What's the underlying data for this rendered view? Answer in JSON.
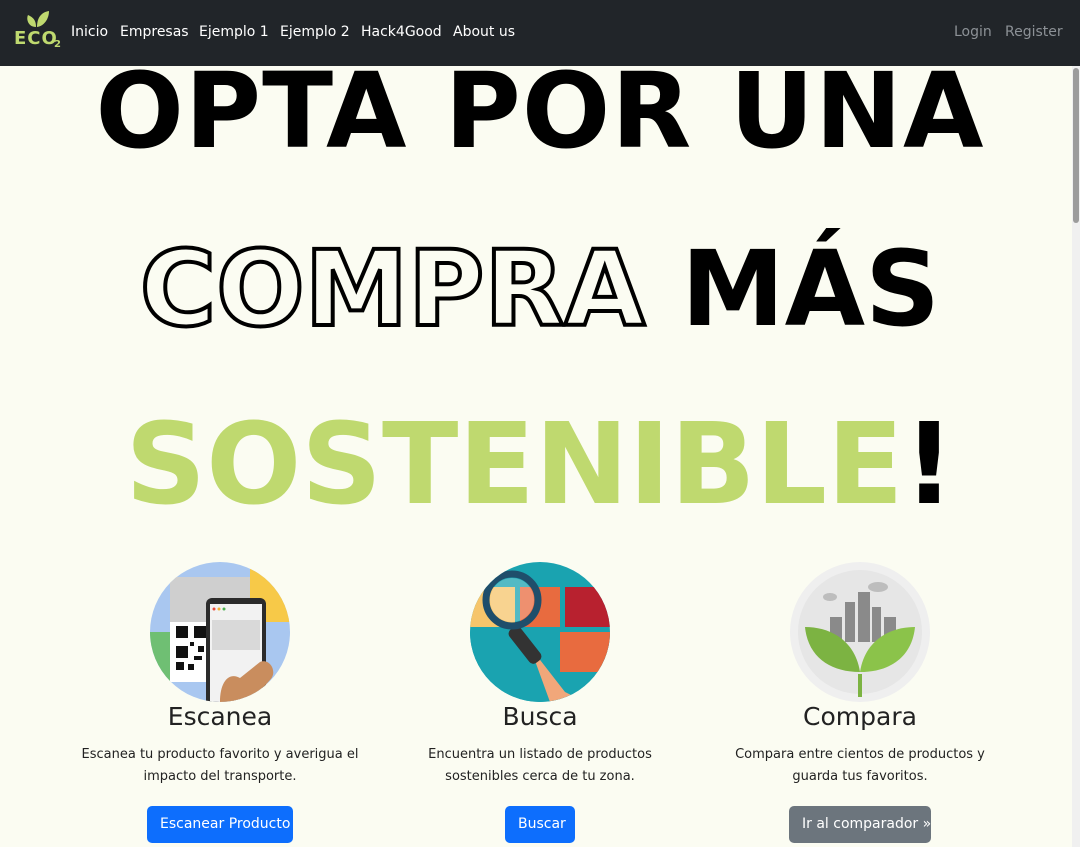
{
  "brand": {
    "word": "ECO",
    "sub": "2"
  },
  "nav": {
    "items": [
      "Inicio",
      "Empresas",
      "Ejemplo 1",
      "Ejemplo 2",
      "Hack4Good",
      "About us"
    ],
    "login": "Login",
    "register": "Register"
  },
  "hero": {
    "line1": "OPTA POR  UNA",
    "line2_outline": "COMPRA",
    "line2_solid": "MÁS",
    "line3_green": "SOSTENIBLE",
    "line3_exclaim": "!"
  },
  "features": [
    {
      "title": "Escanea",
      "line1": "Escanea tu producto favorito y averigua el",
      "line2": "impacto del transporte.",
      "button": "Escanear Producto",
      "icon": "qr-phone-icon"
    },
    {
      "title": "Busca",
      "line1": "Encuentra un listado de productos",
      "line2": "sostenibles cerca de tu zona.",
      "button": "Buscar",
      "icon": "magnifier-icon"
    },
    {
      "title": "Compara",
      "line1": "Compara entre cientos de productos y",
      "line2": "guarda tus favoritos.",
      "button": "Ir al comparador »",
      "icon": "city-leaves-icon"
    }
  ],
  "colors": {
    "navbar": "#212529",
    "accent_green": "#bfd96f",
    "primary_button": "#0d6efd",
    "secondary_button": "#6c757d",
    "background": "#fbfcf2"
  }
}
